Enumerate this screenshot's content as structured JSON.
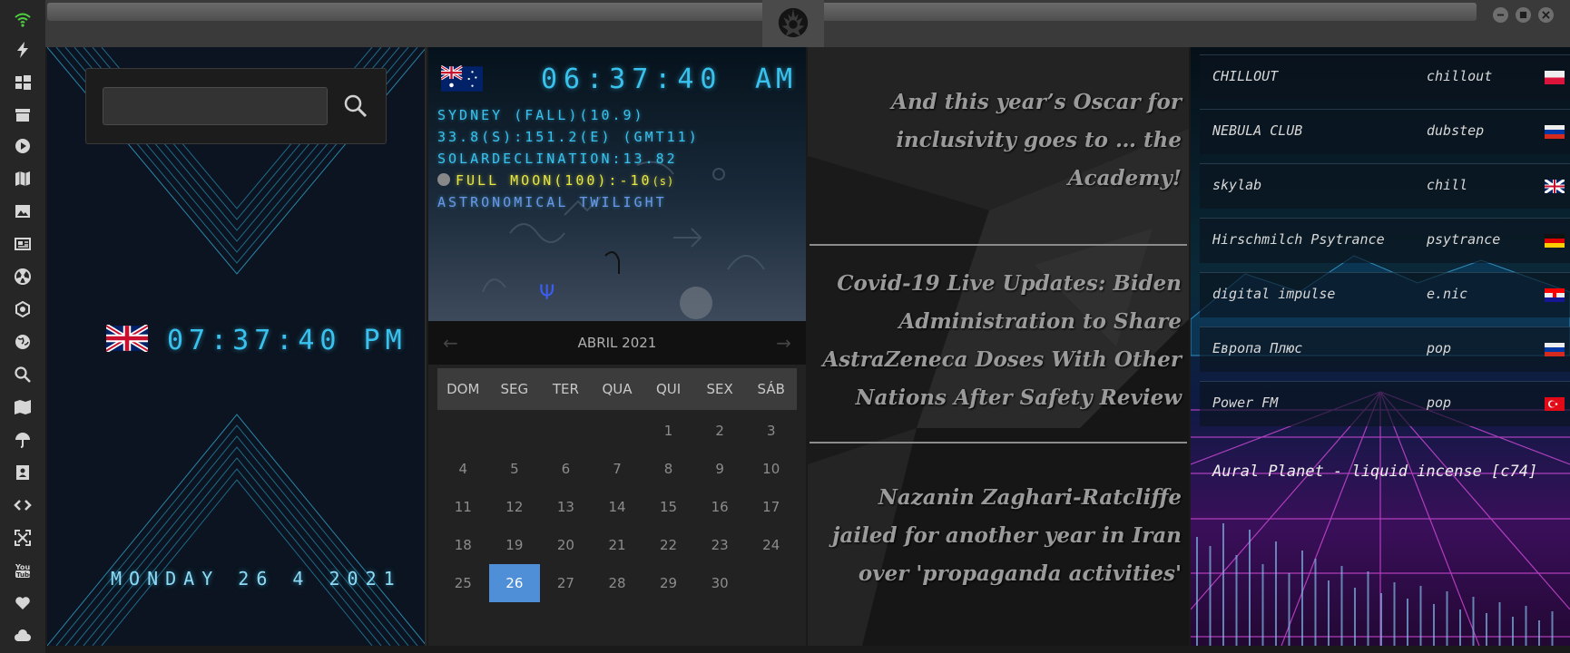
{
  "window": {
    "emblem_icon": "rebel-alliance-icon",
    "controls": [
      "minimize-icon",
      "maximize-icon",
      "close-icon"
    ]
  },
  "sidebar": {
    "icons": [
      "wifi-icon",
      "lightning-icon",
      "windows-icon",
      "archive-icon",
      "play-circle-icon",
      "map-book-icon",
      "image-icon",
      "news-icon",
      "radiation-icon",
      "hexagon-icon",
      "globe-icon",
      "search-icon",
      "map-icon",
      "umbrella-icon",
      "contacts-icon",
      "code-icon",
      "fullscreen-icon",
      "youtube-icon",
      "heart-icon",
      "cloud-icon"
    ],
    "accent_color": "#4fcf3f"
  },
  "world_clock": {
    "search_placeholder": "",
    "flag": "united-kingdom-flag",
    "time": "07:37:40 PM",
    "date": "MONDAY 26 4 2021",
    "accent_color": "#39c2ee"
  },
  "astro": {
    "flag": "australia-flag",
    "time": "06:37:40",
    "ampm": "AM",
    "location_line": "SYDNEY (FALL)(10.9)",
    "coords_line": "33.8(S):151.2(E) (GMT11)",
    "declination_line": "SOLARDECLINATION:13.82",
    "moon_line": "FULL MOON(100):-10",
    "moon_suffix": "(s)",
    "twilight_line": "ASTRONOMICAL TWILIGHT"
  },
  "calendar": {
    "month_label": "ABRIL 2021",
    "prev_label": "←",
    "next_label": "→",
    "weekdays": [
      "DOM",
      "SEG",
      "TER",
      "QUA",
      "QUI",
      "SEX",
      "SÁB"
    ],
    "leading_blanks": 4,
    "days": [
      "1",
      "2",
      "3",
      "4",
      "5",
      "6",
      "7",
      "8",
      "9",
      "10",
      "11",
      "12",
      "13",
      "14",
      "15",
      "16",
      "17",
      "18",
      "19",
      "20",
      "21",
      "22",
      "23",
      "24",
      "25",
      "26",
      "27",
      "28",
      "29",
      "30"
    ],
    "selected_day": "26",
    "selected_color": "#4f8fd8"
  },
  "news": {
    "headlines": [
      "And this year’s Oscar for inclusivity goes to … the Academy!",
      "Covid-19 Live Updates: Biden Administration to Share AstraZeneca Doses With Other Nations After Safety Review",
      "Nazanin Zaghari-Ratcliffe jailed for another year in Iran over 'propaganda activities'"
    ]
  },
  "radio": {
    "stations": [
      {
        "name": "CHILLOUT",
        "genre": "chillout",
        "flag": "poland-flag"
      },
      {
        "name": "NEBULA CLUB",
        "genre": "dubstep",
        "flag": "russia-flag"
      },
      {
        "name": "skylab",
        "genre": "chill",
        "flag": "united-kingdom-flag"
      },
      {
        "name": "Hirschmilch Psytrance",
        "genre": "psytrance",
        "flag": "germany-flag"
      },
      {
        "name": "digital impulse",
        "genre": "e.nic",
        "flag": "croatia-flag"
      },
      {
        "name": "Европа Плюс",
        "genre": "pop",
        "flag": "russia-flag"
      },
      {
        "name": "Power FM",
        "genre": "pop",
        "flag": "turkey-flag"
      }
    ],
    "now_playing": "Aural Planet - liquid incense [c74]"
  }
}
